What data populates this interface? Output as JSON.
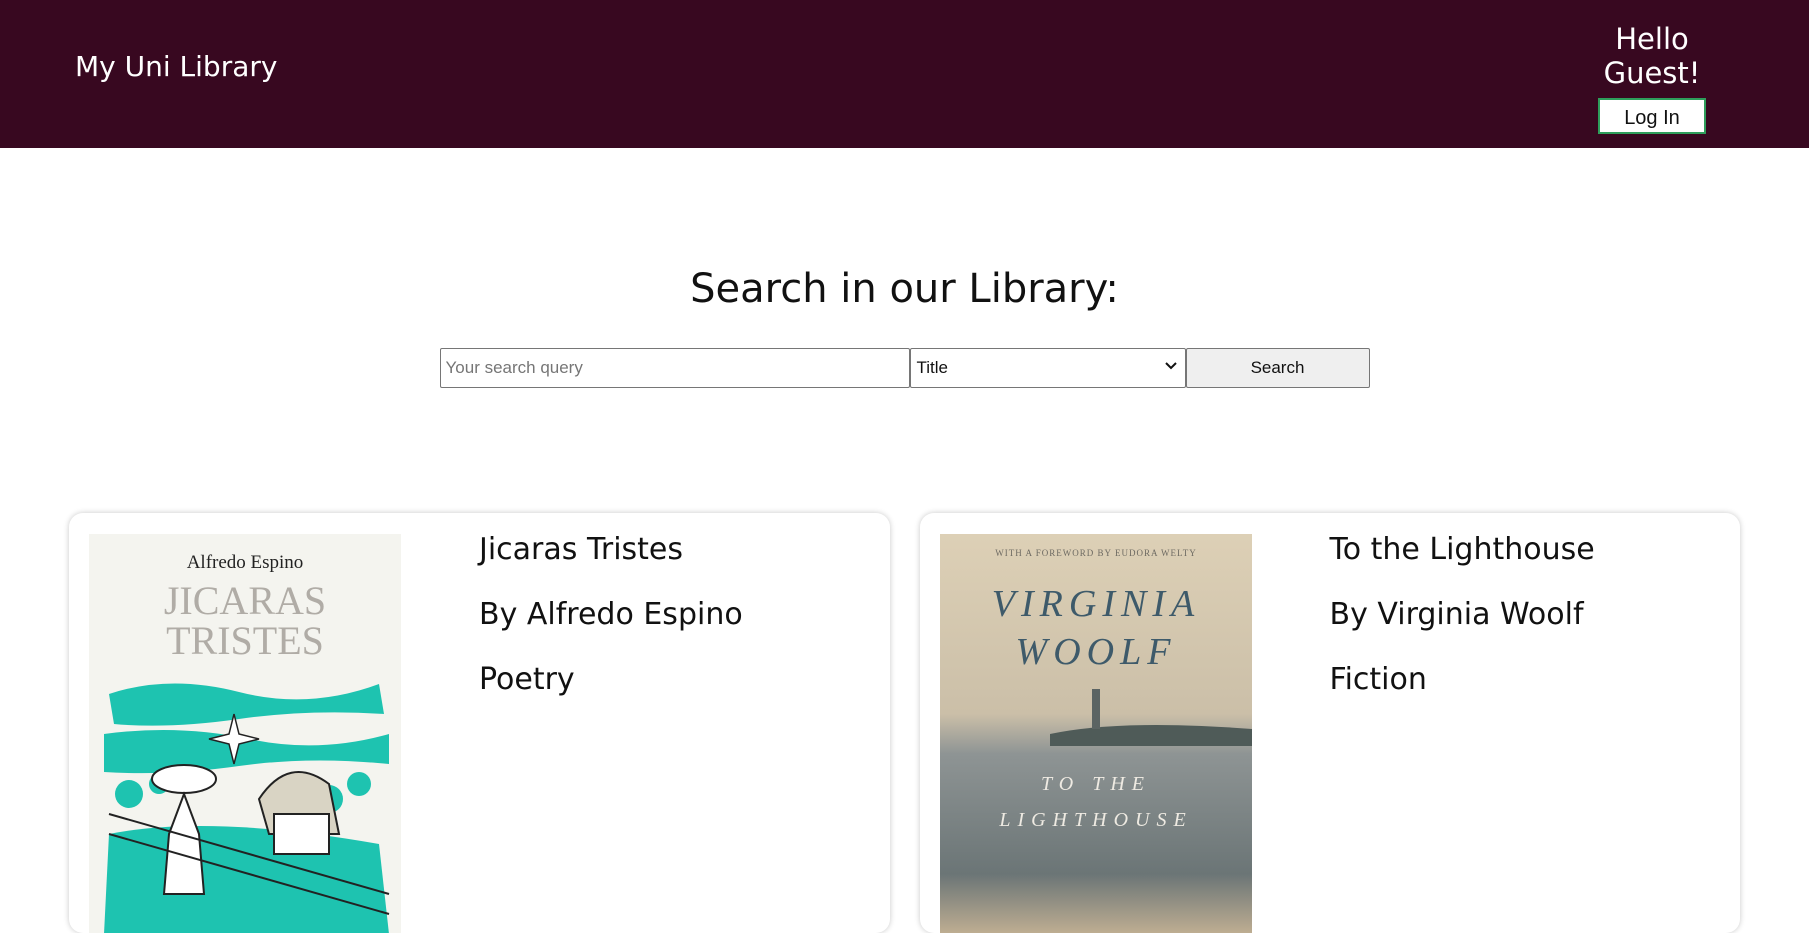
{
  "header": {
    "brand": "My Uni Library",
    "greeting": "Hello Guest!",
    "login_label": "Log In",
    "background": "#380820"
  },
  "search": {
    "heading": "Search in our Library:",
    "placeholder": "Your search query",
    "selected_option": "Title",
    "button_label": "Search"
  },
  "books": [
    {
      "title": "Jicaras Tristes",
      "author": "By Alfredo Espino",
      "genre": "Poetry",
      "cover": {
        "author_text": "Alfredo Espino",
        "title_line1": "JICARAS",
        "title_line2": "TRISTES"
      }
    },
    {
      "title": "To the Lighthouse",
      "author": "By Virginia Woolf",
      "genre": "Fiction",
      "cover": {
        "foreword_text": "WITH A FOREWORD BY EUDORA WELTY",
        "author_line1": "VIRGINIA",
        "author_line2": "WOOLF",
        "title_line1": "TO THE",
        "title_line2": "LIGHTHOUSE"
      }
    }
  ]
}
